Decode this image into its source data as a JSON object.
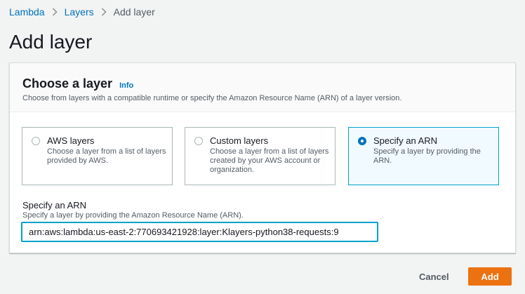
{
  "breadcrumb": {
    "items": [
      "Lambda",
      "Layers",
      "Add layer"
    ]
  },
  "page": {
    "title": "Add layer"
  },
  "panel": {
    "title": "Choose a layer",
    "info": "Info",
    "description": "Choose from layers with a compatible runtime or specify the Amazon Resource Name (ARN) of a layer version."
  },
  "layer_options": [
    {
      "title": "AWS layers",
      "description": "Choose a layer from a list of layers provided by AWS.",
      "selected": false
    },
    {
      "title": "Custom layers",
      "description": "Choose a layer from a list of layers created by your AWS account or organization.",
      "selected": false
    },
    {
      "title": "Specify an ARN",
      "description": "Specify a layer by providing the ARN.",
      "selected": true
    }
  ],
  "arn_field": {
    "label": "Specify an ARN",
    "description": "Specify a layer by providing the Amazon Resource Name (ARN).",
    "value": "arn:aws:lambda:us-east-2:770693421928:layer:Klayers-python38-requests:9"
  },
  "footer": {
    "cancel_label": "Cancel",
    "add_label": "Add"
  },
  "colors": {
    "link": "#0073bb",
    "primary_button": "#ec7211",
    "selected_border": "#00a1c9",
    "selected_background": "#f1faff"
  }
}
